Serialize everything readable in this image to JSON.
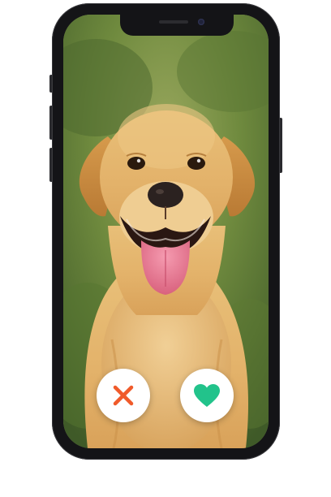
{
  "app": {
    "photo_subject_icon": "labrador-dog-photo"
  },
  "actions": {
    "dislike": {
      "icon": "close-x-icon",
      "color": "#f05a2a"
    },
    "like": {
      "icon": "heart-icon",
      "color": "#22c38b"
    }
  },
  "colors": {
    "phone_frame": "#141417",
    "button_bg": "#ffffff"
  }
}
